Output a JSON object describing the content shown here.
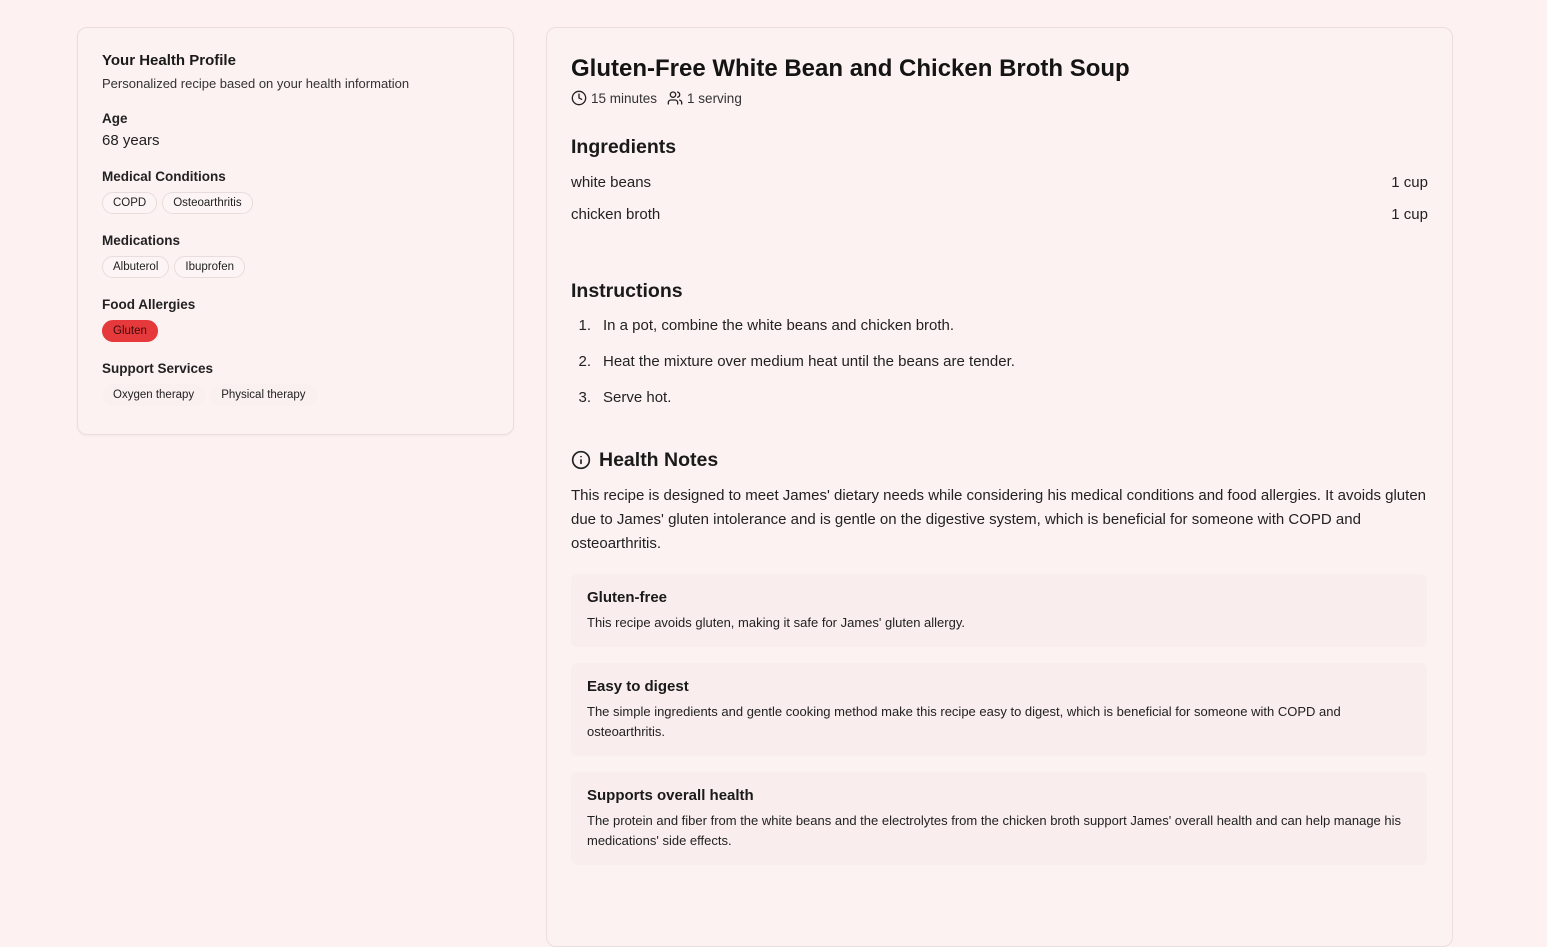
{
  "profile": {
    "title": "Your Health Profile",
    "subtitle": "Personalized recipe based on your health information",
    "age_label": "Age",
    "age_value": "68 years",
    "conditions_label": "Medical Conditions",
    "conditions": [
      "COPD",
      "Osteoarthritis"
    ],
    "medications_label": "Medications",
    "medications": [
      "Albuterol",
      "Ibuprofen"
    ],
    "allergies_label": "Food Allergies",
    "allergies": [
      "Gluten"
    ],
    "services_label": "Support Services",
    "services": [
      "Oxygen therapy",
      "Physical therapy"
    ]
  },
  "recipe": {
    "title": "Gluten-Free White Bean and Chicken Broth Soup",
    "time": "15 minutes",
    "servings": "1 serving",
    "ingredients_heading": "Ingredients",
    "ingredients": [
      {
        "name": "white beans",
        "amount": "1 cup"
      },
      {
        "name": "chicken broth",
        "amount": "1 cup"
      }
    ],
    "instructions_heading": "Instructions",
    "steps": [
      {
        "num": "1.",
        "text": "In a pot, combine the white beans and chicken broth."
      },
      {
        "num": "2.",
        "text": "Heat the mixture over medium heat until the beans are tender."
      },
      {
        "num": "3.",
        "text": "Serve hot."
      }
    ],
    "notes_heading": "Health Notes",
    "notes_text": "This recipe is designed to meet James' dietary needs while considering his medical conditions and food allergies. It avoids gluten due to James' gluten intolerance and is gentle on the digestive system, which is beneficial for someone with COPD and osteoarthritis.",
    "notes": [
      {
        "title": "Gluten-free",
        "desc": "This recipe avoids gluten, making it safe for James' gluten allergy."
      },
      {
        "title": "Easy to digest",
        "desc": "The simple ingredients and gentle cooking method make this recipe easy to digest, which is beneficial for someone with COPD and osteoarthritis."
      },
      {
        "title": "Supports overall health",
        "desc": "The protein and fiber from the white beans and the electrolytes from the chicken broth support James' overall health and can help manage his medications' side effects."
      }
    ]
  },
  "colors": {
    "background": "#fdf1f1",
    "allergy_chip": "#e5393b"
  }
}
